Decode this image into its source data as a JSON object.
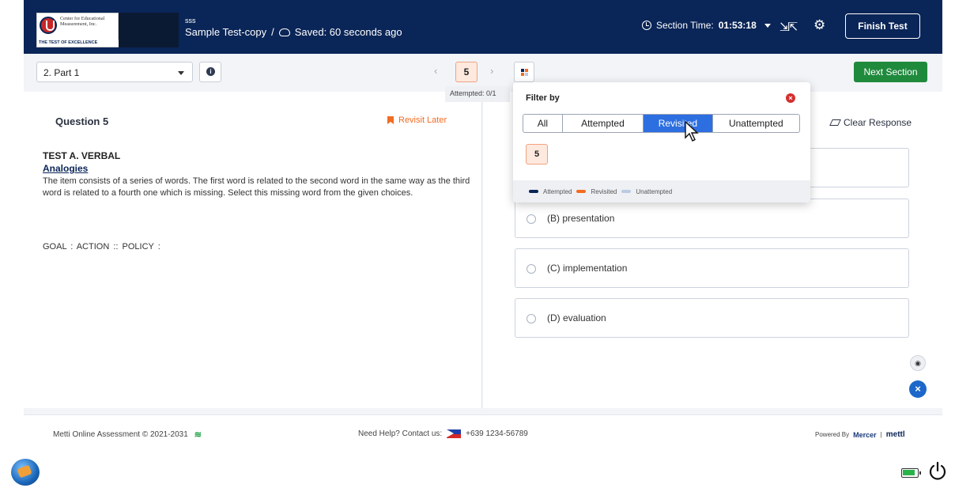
{
  "header": {
    "logo_org_text": "Center for Educational Measurement, Inc.",
    "logo_tagline": "THE TEST OF EXCELLENCE",
    "sub_label": "sss",
    "test_title": "Sample Test-copy",
    "separator": "/",
    "saved_status": "Saved: 60 seconds ago",
    "section_time_label": "Section Time:",
    "section_time_value": "01:53:18",
    "finish_button": "Finish Test",
    "colors": {
      "header_bg": "#0a2557"
    }
  },
  "toolbar": {
    "part_select_value": "2. Part 1",
    "nav_prev": "‹",
    "current_question": "5",
    "nav_next": "›",
    "next_section_button": "Next Section",
    "attempted_count": "Attempted: 0/1",
    "colors": {
      "next_section": "#1f8a3c",
      "current_question_bg": "#fde9de"
    }
  },
  "question": {
    "title": "Question 5",
    "revisit_label": "Revisit Later",
    "test_heading": "TEST A. VERBAL",
    "topic": "Analogies",
    "instructions": "The item consists of a series of words. The first word is related to the second word in the same way as the third word is related to a fourth one which is missing.  Select this missing word from the given choices.",
    "stem": "GOAL : ACTION :: POLICY :"
  },
  "answers": {
    "clear_response": "Clear Response",
    "options": [
      {
        "label": "(B) presentation"
      },
      {
        "label": "(C) implementation"
      },
      {
        "label": "(D) evaluation"
      }
    ]
  },
  "filter": {
    "title": "Filter by",
    "tabs": [
      "All",
      "Attempted",
      "Revisited",
      "Unattempted"
    ],
    "active_tab": "Revisited",
    "question_chips": [
      "5"
    ],
    "legend": [
      {
        "label": "Attempted",
        "color": "#0a2557"
      },
      {
        "label": "Revisited",
        "color": "#f26c22"
      },
      {
        "label": "Unattempted",
        "color": "#b9cbe3"
      }
    ]
  },
  "footer": {
    "copyright": "Metti Online Assessment © 2021-2031",
    "help_text": "Need Help? Contact us:",
    "phone": "+639 1234-56789",
    "powered_by": "Powered By",
    "brand_mercer": "Mercer",
    "brand_divider": "|",
    "brand_mettl": "mettl"
  },
  "icons": {
    "clock": "clock-icon",
    "compress": "compress-icon",
    "settings": "gear-icon",
    "info": "info-icon",
    "grid": "grid-icon",
    "bookmark": "bookmark-icon",
    "eraser": "eraser-icon",
    "eye": "eye-icon",
    "close": "close-icon",
    "wifi": "wifi-icon",
    "flag": "philippines-flag-icon",
    "battery": "battery-icon",
    "power": "power-icon"
  }
}
